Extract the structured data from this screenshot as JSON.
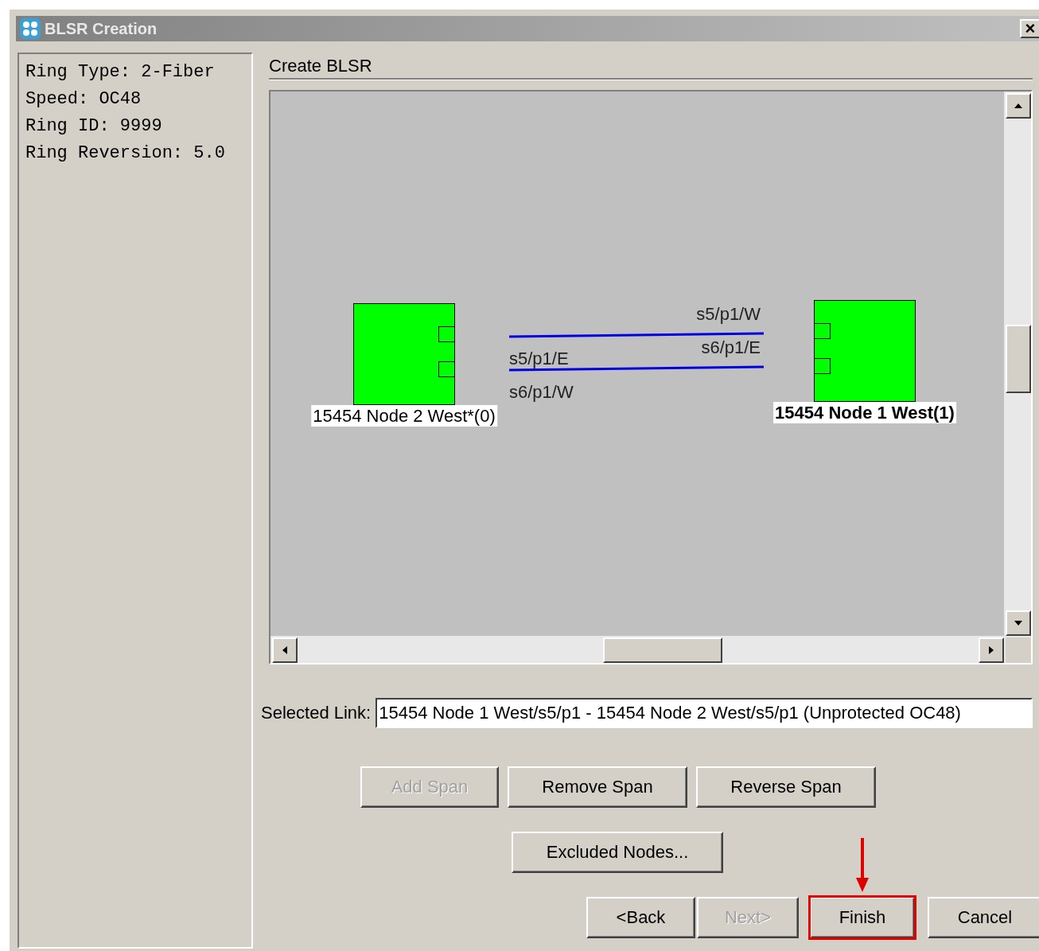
{
  "window": {
    "title": "BLSR Creation",
    "close": "×"
  },
  "ring_info": [
    "Ring Type: 2-Fiber",
    "Speed: OC48",
    "Ring ID: 9999",
    "Ring Reversion: 5.0"
  ],
  "section_title": "Create BLSR",
  "diagram": {
    "nodes": [
      {
        "label": "15454 Node 2 West*(0)",
        "selected": false
      },
      {
        "label": "15454 Node 1 West(1)",
        "selected": true
      }
    ],
    "port_labels": [
      "s5/p1/W",
      "s6/p1/E",
      "s5/p1/E",
      "s6/p1/W"
    ]
  },
  "selected_link": {
    "label": "Selected Link:",
    "value": "15454 Node 1 West/s5/p1 - 15454 Node 2 West/s5/p1 (Unprotected OC48)"
  },
  "span_buttons": [
    {
      "label": "Add Span",
      "disabled": true
    },
    {
      "label": "Remove Span",
      "disabled": false
    },
    {
      "label": "Reverse Span",
      "disabled": false
    }
  ],
  "excluded_button": {
    "label": "Excluded Nodes...",
    "disabled": false
  },
  "wizard_buttons": [
    {
      "label": "<Back",
      "disabled": false,
      "highlighted": false
    },
    {
      "label": "Next>",
      "disabled": true,
      "highlighted": false
    },
    {
      "label": "Finish",
      "disabled": false,
      "highlighted": true
    },
    {
      "label": "Cancel",
      "disabled": false,
      "highlighted": false
    }
  ]
}
